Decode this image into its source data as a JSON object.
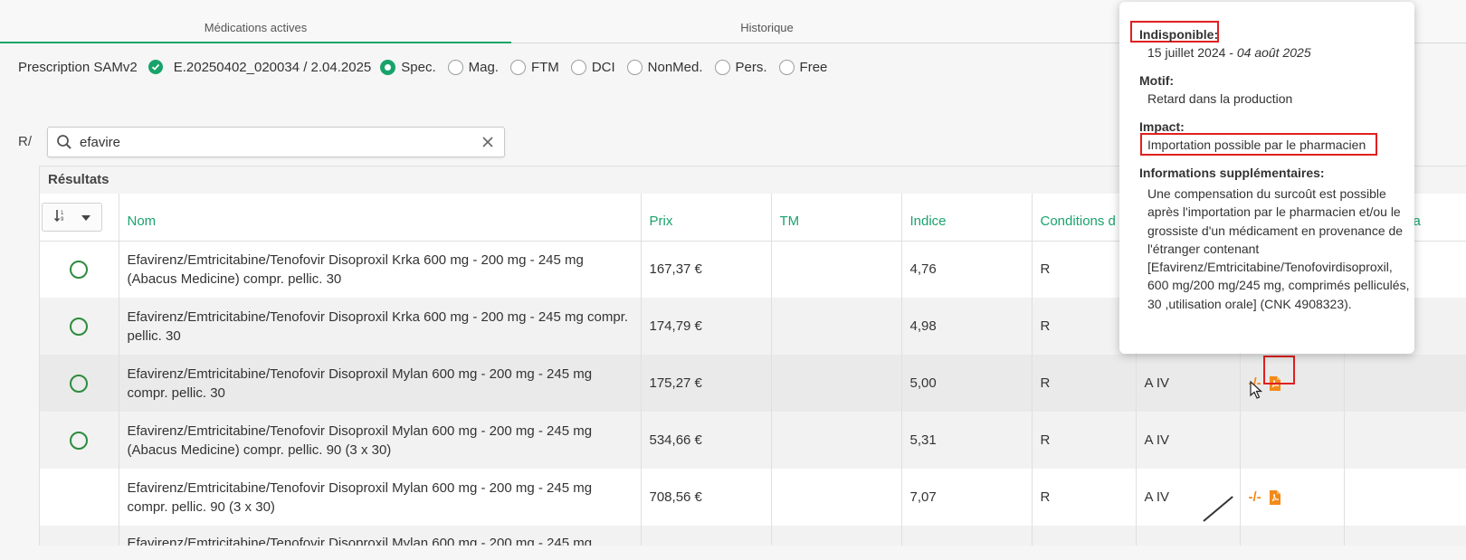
{
  "tabs": [
    {
      "label": "Médications actives",
      "active": true
    },
    {
      "label": "Historique",
      "active": false
    }
  ],
  "prescription": {
    "label": "Prescription SAMv2",
    "id": "E.20250402_020034 / 2.04.2025",
    "options": [
      "Spec.",
      "Mag.",
      "FTM",
      "DCI",
      "NonMed.",
      "Pers.",
      "Free"
    ],
    "selected": "Spec."
  },
  "search": {
    "prefix": "R/",
    "value": "efavire"
  },
  "results": {
    "title": "Résultats",
    "columns": {
      "nom": "Nom",
      "prix": "Prix",
      "tm": "TM",
      "indice": "Indice",
      "conditions": "Conditions d",
      "last": "a"
    },
    "rows": [
      {
        "name": "Efavirenz/Emtricitabine/Tenofovir Disoproxil Krka 600 mg - 200 mg - 245 mg (Abacus Medicine) compr. pellic. 30",
        "prix": "167,37 €",
        "tm": "",
        "indice": "4,76",
        "cond": "R",
        "cat": "",
        "avail": "",
        "selectable": true
      },
      {
        "name": "Efavirenz/Emtricitabine/Tenofovir Disoproxil Krka 600 mg - 200 mg - 245 mg compr. pellic. 30",
        "prix": "174,79 €",
        "tm": "",
        "indice": "4,98",
        "cond": "R",
        "cat": "",
        "avail": "",
        "selectable": true
      },
      {
        "name": "Efavirenz/Emtricitabine/Tenofovir Disoproxil Mylan 600 mg - 200 mg - 245 mg compr. pellic. 30",
        "prix": "175,27 €",
        "tm": "",
        "indice": "5,00",
        "cond": "R",
        "cat": "A IV",
        "avail": "-/-",
        "selectable": true
      },
      {
        "name": "Efavirenz/Emtricitabine/Tenofovir Disoproxil Mylan 600 mg - 200 mg - 245 mg (Abacus Medicine) compr. pellic. 90 (3 x 30)",
        "prix": "534,66 €",
        "tm": "",
        "indice": "5,31",
        "cond": "R",
        "cat": "A IV",
        "avail": "",
        "selectable": true
      },
      {
        "name": "Efavirenz/Emtricitabine/Tenofovir Disoproxil Mylan 600 mg - 200 mg - 245 mg compr. pellic. 90 (3 x 30)",
        "prix": "708,56 €",
        "tm": "",
        "indice": "7,07",
        "cond": "R",
        "cat": "A IV",
        "avail": "-/-",
        "selectable": false
      },
      {
        "name": "Efavirenz/Emtricitabine/Tenofovir Disoproxil Mylan 600 mg - 200 mg - 245 mg",
        "prix": "",
        "tm": "",
        "indice": "",
        "cond": "",
        "cat": "",
        "avail": "",
        "selectable": false
      }
    ]
  },
  "popover": {
    "unavailable_label": "Indisponible:",
    "unavailable_from": "15 juillet 2024",
    "unavailable_sep": " - ",
    "unavailable_to": "04 août 2025",
    "motif_label": "Motif:",
    "motif_value": "Retard dans la production",
    "impact_label": "Impact:",
    "impact_value": "Importation possible par le pharmacien",
    "extra_label": "Informations supplémentaires:",
    "extra_value": "Une compensation du surcoût est possible après l'importation par le pharmacien et/ou le grossiste d'un médicament en provenance de l'étranger contenant [Efavirenz/Emtricitabine/Tenofovirdisoproxil, 600 mg/200 mg/245 mg, comprimés pelliculés, 30 ,utilisation orale] (CNK 4908323)."
  },
  "colors": {
    "accent": "#1aa36b",
    "warning": "#f28a1a",
    "highlight": "#e02020"
  }
}
